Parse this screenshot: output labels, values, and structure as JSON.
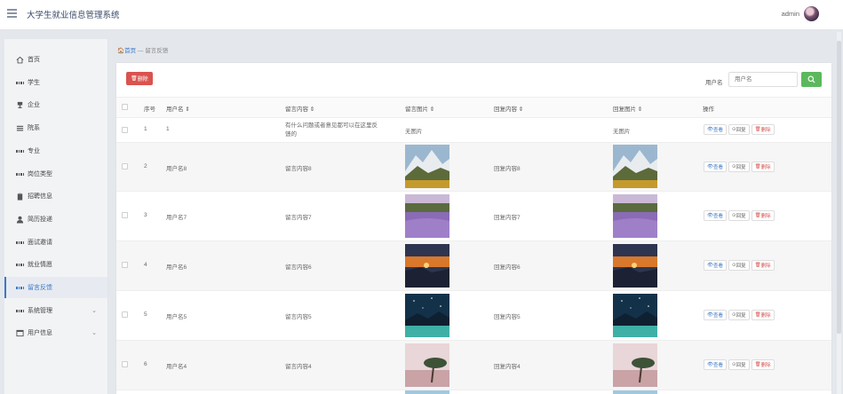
{
  "header": {
    "title": "大学生就业信息管理系统",
    "user": "admin"
  },
  "sidebar": {
    "items": [
      {
        "label": "首页",
        "icon": "home-icon"
      },
      {
        "label": "学生",
        "icon": "grid-icon"
      },
      {
        "label": "企业",
        "icon": "trophy-icon"
      },
      {
        "label": "院系",
        "icon": "list-icon"
      },
      {
        "label": "专业",
        "icon": "grid-icon"
      },
      {
        "label": "岗位类型",
        "icon": "grid-icon"
      },
      {
        "label": "招聘信息",
        "icon": "clipboard-icon"
      },
      {
        "label": "简历投递",
        "icon": "user-icon"
      },
      {
        "label": "面试邀请",
        "icon": "grid-icon"
      },
      {
        "label": "就业情愿",
        "icon": "grid-icon"
      },
      {
        "label": "留言反馈",
        "icon": "grid-icon",
        "active": true
      },
      {
        "label": "系统管理",
        "icon": "grid-icon",
        "expandable": true
      },
      {
        "label": "用户信息",
        "icon": "window-icon",
        "expandable": true
      }
    ]
  },
  "breadcrumb": {
    "home": "首页",
    "separator": "—",
    "current": "留言反馈"
  },
  "toolbar": {
    "delete_label": "删除",
    "search_label": "用户名",
    "search_placeholder": "用户名"
  },
  "table": {
    "headers": {
      "index": "序号",
      "username": "用户名",
      "content": "留言内容",
      "image": "留言图片",
      "reply": "回复内容",
      "reply_image": "回复图片",
      "actions": "操作"
    },
    "actions": {
      "view": "查看",
      "reply": "回复",
      "delete": "删除"
    },
    "rows": [
      {
        "index": "1",
        "username": "1",
        "content": "有什么问题或者意见都可以在这里反馈的",
        "image": "无图片",
        "reply": "",
        "reply_image": "无图片"
      },
      {
        "index": "2",
        "username": "用户名8",
        "content": "留言内容8",
        "image": "mountain",
        "reply": "回复内容8",
        "reply_image": "mountain"
      },
      {
        "index": "3",
        "username": "用户名7",
        "content": "留言内容7",
        "image": "lavender",
        "reply": "回复内容7",
        "reply_image": "lavender"
      },
      {
        "index": "4",
        "username": "用户名6",
        "content": "留言内容6",
        "image": "sunset",
        "reply": "回复内容6",
        "reply_image": "sunset"
      },
      {
        "index": "5",
        "username": "用户名5",
        "content": "留言内容5",
        "image": "starry-lake",
        "reply": "回复内容5",
        "reply_image": "starry-lake"
      },
      {
        "index": "6",
        "username": "用户名4",
        "content": "留言内容4",
        "image": "pink-tree",
        "reply": "回复内容4",
        "reply_image": "pink-tree"
      }
    ]
  },
  "colors": {
    "accent": "#3b78c8",
    "danger": "#d9534f",
    "success": "#5cb85c"
  }
}
